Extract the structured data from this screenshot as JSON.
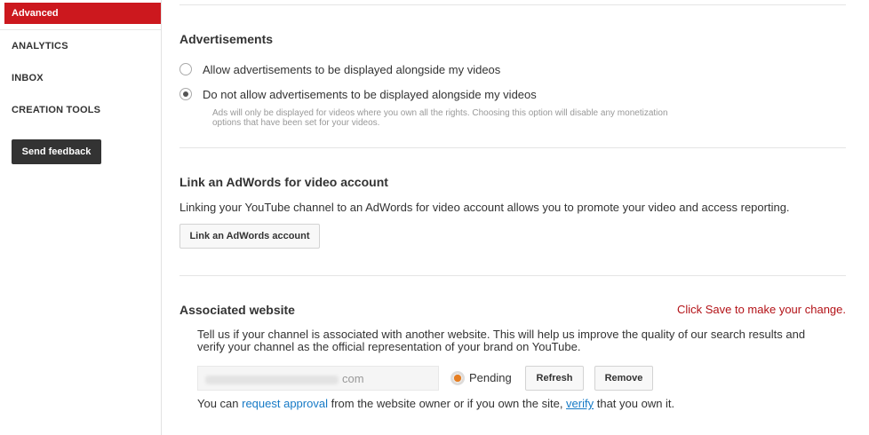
{
  "sidebar": {
    "active": "Advanced",
    "items": [
      "ANALYTICS",
      "INBOX",
      "CREATION TOOLS"
    ],
    "feedback": "Send feedback"
  },
  "ads": {
    "heading": "Advertisements",
    "opt_allow": "Allow advertisements to be displayed alongside my videos",
    "opt_disallow": "Do not allow advertisements to be displayed alongside my videos",
    "selected": "disallow",
    "note": "Ads will only be displayed for videos where you own all the rights. Choosing this option will disable any monetization options that have been set for your videos."
  },
  "adwords": {
    "heading": "Link an AdWords for video account",
    "desc": "Linking your YouTube channel to an AdWords for video account allows you to promote your video and access reporting.",
    "button": "Link an AdWords account"
  },
  "website": {
    "heading": "Associated website",
    "save_note": "Click Save to make your change.",
    "desc": "Tell us if your channel is associated with another website. This will help us improve the quality of our search results and verify your channel as the official representation of your brand on YouTube.",
    "url_suffix": "com",
    "status": "Pending",
    "refresh": "Refresh",
    "remove": "Remove",
    "footer_1": "You can ",
    "footer_link1": "request approval",
    "footer_2": " from the website owner or if you own the site, ",
    "footer_link2": "verify",
    "footer_3": " that you own it."
  },
  "colors": {
    "accent_red": "#cc181e",
    "link_blue": "#167ac6",
    "pending_orange": "#e67e22"
  }
}
